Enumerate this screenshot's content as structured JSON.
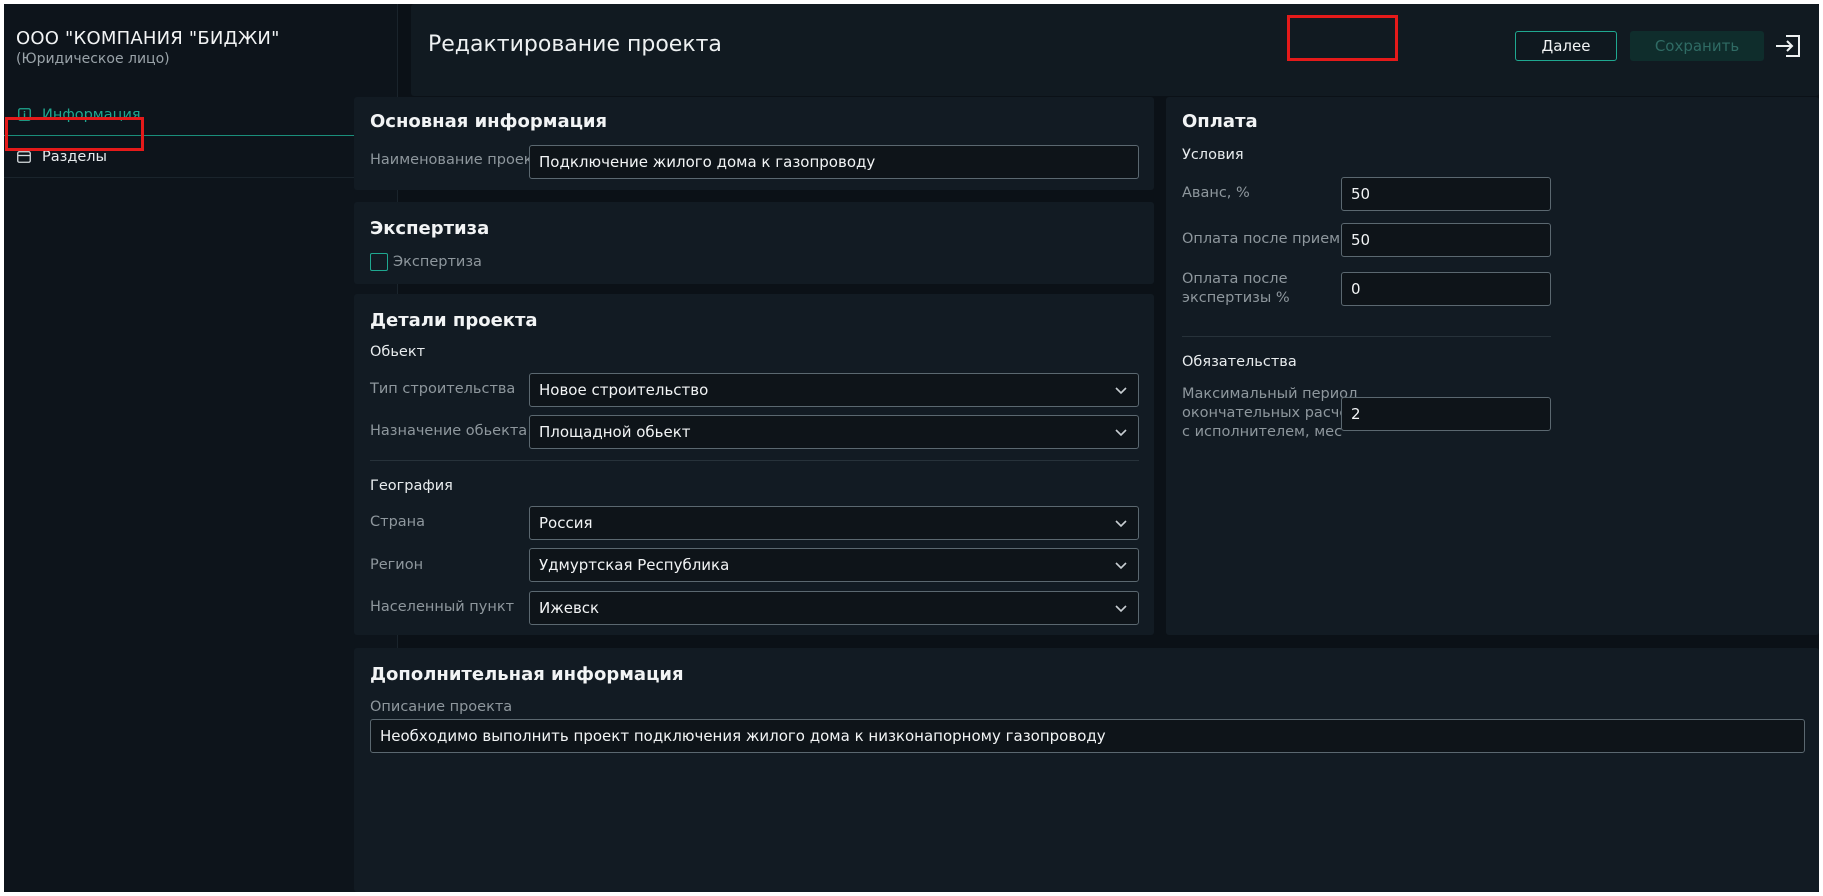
{
  "sidebar": {
    "company_name": "ООО \"КОМПАНИЯ \"БИДЖИ\"",
    "company_type": "(Юридическое лицо)",
    "items": [
      {
        "label": "Информация",
        "icon": "info-icon"
      },
      {
        "label": "Разделы",
        "icon": "sections-icon"
      }
    ]
  },
  "header": {
    "title": "Редактирование проекта",
    "next_label": "Далее",
    "save_label": "Сохранить"
  },
  "basic": {
    "title": "Основная информация",
    "name_label": "Наименование проекта",
    "name_value": "Подключение жилого дома к газопроводу"
  },
  "expertise": {
    "title": "Экспертиза",
    "checkbox_label": "Экспертиза",
    "checked": false
  },
  "details": {
    "title": "Детали проекта",
    "object_subtitle": "Обьект",
    "construction_type_label": "Тип строительства",
    "construction_type_value": "Новое строительство",
    "purpose_label": "Назначение обьекта",
    "purpose_value": "Площадной обьект",
    "geo_subtitle": "География",
    "country_label": "Страна",
    "country_value": "Россия",
    "region_label": "Регион",
    "region_value": "Удмуртская Республика",
    "city_label": "Населенный пункт",
    "city_value": "Ижевск"
  },
  "payment": {
    "title": "Оплата",
    "conditions_subtitle": "Условия",
    "advance_label": "Аванс, %",
    "advance_value": "50",
    "after_accept_label": "Оплата после приемки %",
    "after_accept_value": "50",
    "after_expertise_label_1": "Оплата после",
    "after_expertise_label_2": "экспертизы %",
    "after_expertise_value": "0",
    "obligations_subtitle": "Обязательства",
    "max_period_label_1": "Максимальный период",
    "max_period_label_2": "окончательных расчётов",
    "max_period_label_3": "с исполнителем, мес",
    "max_period_value": "2"
  },
  "additional": {
    "title": "Дополнительная информация",
    "description_label": "Описание проекта",
    "description_value": "Необходимо выполнить проект подключения жилого дома к низконапорному газопроводу"
  },
  "colors": {
    "accent": "#1fa890",
    "background": "#0b1117",
    "card": "#121b23",
    "highlight": "#e51a1a"
  }
}
